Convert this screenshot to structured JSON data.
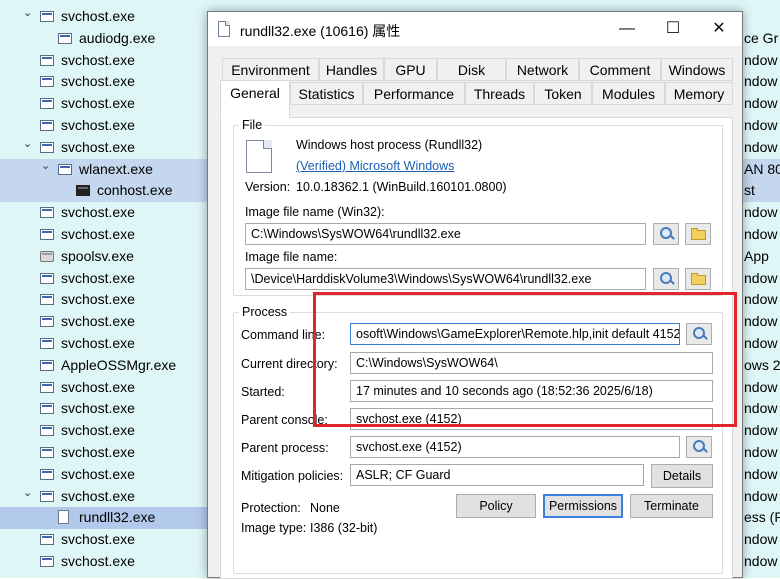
{
  "tree": {
    "rows": [
      {
        "name": "svchost.exe",
        "icon": "window-icon",
        "indent": 1,
        "expander": "chevron-down",
        "state": ""
      },
      {
        "name": "audiodg.exe",
        "icon": "window-icon",
        "indent": 2,
        "expander": "",
        "state": ""
      },
      {
        "name": "svchost.exe",
        "icon": "window-icon",
        "indent": 1,
        "expander": "",
        "state": ""
      },
      {
        "name": "svchost.exe",
        "icon": "window-icon",
        "indent": 1,
        "expander": "",
        "state": ""
      },
      {
        "name": "svchost.exe",
        "icon": "window-icon",
        "indent": 1,
        "expander": "",
        "state": ""
      },
      {
        "name": "svchost.exe",
        "icon": "window-icon",
        "indent": 1,
        "expander": "",
        "state": ""
      },
      {
        "name": "svchost.exe",
        "icon": "window-icon",
        "indent": 1,
        "expander": "chevron-down",
        "state": ""
      },
      {
        "name": "wlanext.exe",
        "icon": "window-icon",
        "indent": 2,
        "expander": "chevron-down",
        "state": "highlight"
      },
      {
        "name": "conhost.exe",
        "icon": "console-icon",
        "indent": 3,
        "expander": "",
        "state": "highlight"
      },
      {
        "name": "svchost.exe",
        "icon": "window-icon",
        "indent": 1,
        "expander": "",
        "state": ""
      },
      {
        "name": "svchost.exe",
        "icon": "window-icon",
        "indent": 1,
        "expander": "",
        "state": ""
      },
      {
        "name": "spoolsv.exe",
        "icon": "printer-icon",
        "indent": 1,
        "expander": "",
        "state": ""
      },
      {
        "name": "svchost.exe",
        "icon": "window-icon",
        "indent": 1,
        "expander": "",
        "state": ""
      },
      {
        "name": "svchost.exe",
        "icon": "window-icon",
        "indent": 1,
        "expander": "",
        "state": ""
      },
      {
        "name": "svchost.exe",
        "icon": "window-icon",
        "indent": 1,
        "expander": "",
        "state": ""
      },
      {
        "name": "svchost.exe",
        "icon": "window-icon",
        "indent": 1,
        "expander": "",
        "state": ""
      },
      {
        "name": "AppleOSSMgr.exe",
        "icon": "window-icon",
        "indent": 1,
        "expander": "",
        "state": ""
      },
      {
        "name": "svchost.exe",
        "icon": "window-icon",
        "indent": 1,
        "expander": "",
        "state": ""
      },
      {
        "name": "svchost.exe",
        "icon": "window-icon",
        "indent": 1,
        "expander": "",
        "state": ""
      },
      {
        "name": "svchost.exe",
        "icon": "window-icon",
        "indent": 1,
        "expander": "",
        "state": ""
      },
      {
        "name": "svchost.exe",
        "icon": "window-icon",
        "indent": 1,
        "expander": "",
        "state": ""
      },
      {
        "name": "svchost.exe",
        "icon": "window-icon",
        "indent": 1,
        "expander": "",
        "state": ""
      },
      {
        "name": "svchost.exe",
        "icon": "window-icon",
        "indent": 1,
        "expander": "chevron-down",
        "state": ""
      },
      {
        "name": "rundll32.exe",
        "icon": "file-icon",
        "indent": 2,
        "expander": "",
        "state": "selected"
      },
      {
        "name": "svchost.exe",
        "icon": "window-icon",
        "indent": 1,
        "expander": "",
        "state": ""
      },
      {
        "name": "svchost.exe",
        "icon": "window-icon",
        "indent": 1,
        "expander": "",
        "state": ""
      }
    ],
    "right_column": [
      "",
      "ce Gr",
      "ndow",
      "ndow",
      "ndow",
      "ndow",
      "ndow",
      "AN 80",
      "st",
      "ndow",
      "ndow",
      "App",
      "ndow",
      "ndow",
      "ndow",
      "ndow",
      "ows 2",
      "ndow",
      "ndow",
      "ndow",
      "ndow",
      "ndow",
      "ndow",
      "ess (R",
      "ndow",
      "ndow"
    ]
  },
  "dialog": {
    "title": "rundll32.exe (10616) 属性",
    "caption_minimize": "—",
    "caption_maximize": "☐",
    "caption_close": "✕",
    "tabs_row1": [
      "Environment",
      "Handles",
      "GPU",
      "Disk",
      "Network",
      "Comment",
      "Windows"
    ],
    "tabs_row2": [
      "General",
      "Statistics",
      "Performance",
      "Threads",
      "Token",
      "Modules",
      "Memory"
    ],
    "file_group": {
      "title": "File",
      "description": "Windows host process (Rundll32)",
      "company_link": "(Verified) Microsoft Windows",
      "version_label": "Version:",
      "version_value": "10.0.18362.1 (WinBuild.160101.0800)",
      "image_win32_label": "Image file name (Win32):",
      "image_win32_value": "C:\\Windows\\SysWOW64\\rundll32.exe",
      "image_native_label": "Image file name:",
      "image_native_value": "\\Device\\HarddiskVolume3\\Windows\\SysWOW64\\rundll32.exe"
    },
    "process_group": {
      "title": "Process",
      "command_line_label": "Command line:",
      "command_line_value": "osoft\\Windows\\GameExplorer\\Remote.hlp,init default 4152",
      "current_dir_label": "Current directory:",
      "current_dir_value": "C:\\Windows\\SysWOW64\\",
      "started_label": "Started:",
      "started_value": "17 minutes and 10 seconds ago (18:52:36 2025/6/18)",
      "parent_console_label": "Parent console:",
      "parent_console_value": "svchost.exe (4152)",
      "parent_process_label": "Parent process:",
      "parent_process_value": "svchost.exe (4152)",
      "mitigation_label": "Mitigation policies:",
      "mitigation_value": "ASLR; CF Guard",
      "details_button": "Details",
      "protection_label": "Protection:",
      "protection_value": "None",
      "image_type_label": "Image type:",
      "image_type_value": "I386 (32-bit)",
      "policy_button": "Policy",
      "permissions_button": "Permissions",
      "terminate_button": "Terminate"
    }
  },
  "colors": {
    "annotation_box": "#e0262b",
    "tree_background": "#dff6f7",
    "selection": "#b3c9ec",
    "link": "#1a5fb4"
  }
}
